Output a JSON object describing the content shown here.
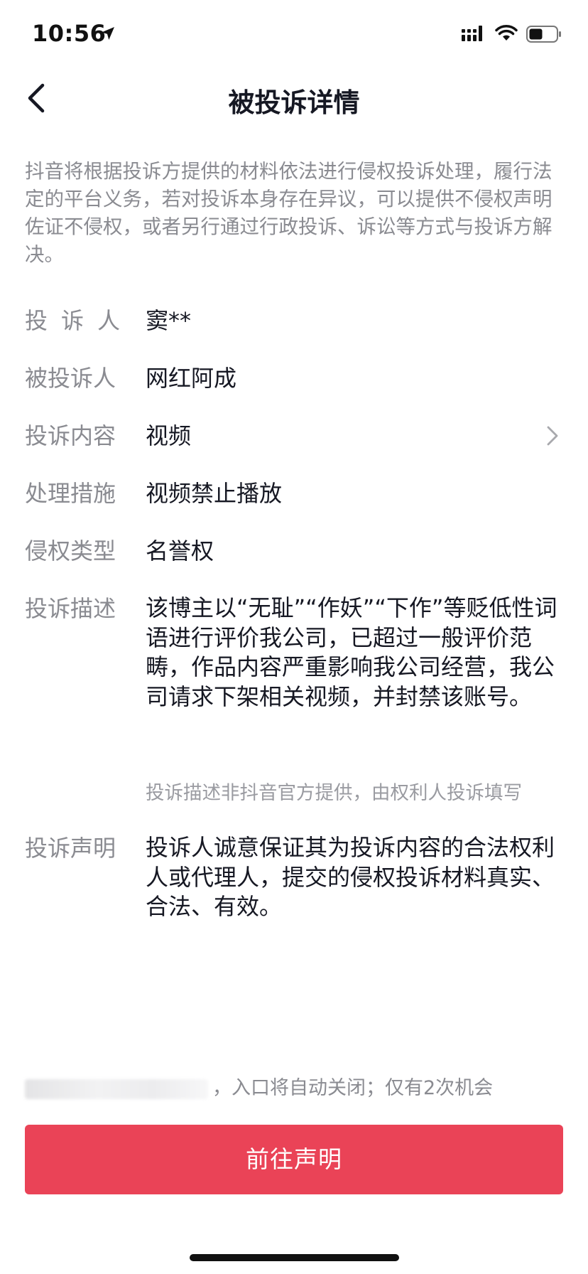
{
  "status_bar": {
    "time": "10:56",
    "icons": [
      "location-arrow-icon",
      "signal-icon",
      "wifi-icon",
      "battery-icon"
    ]
  },
  "nav": {
    "title": "被投诉详情",
    "back_icon": "chevron-left-icon"
  },
  "notice": "抖音将根据投诉方提供的材料依法进行侵权投诉处理，履行法定的平台义务，若对投诉本身存在异议，可以提供不侵权声明佐证不侵权，或者另行通过行政投诉、诉讼等方式与投诉方解决。",
  "details": {
    "complainant": {
      "label": "投诉人",
      "value": "窦**"
    },
    "respondent": {
      "label": "被投诉人",
      "value": "网红阿成"
    },
    "content": {
      "label": "投诉内容",
      "value": "视频",
      "chevron_icon": "chevron-right-icon"
    },
    "measure": {
      "label": "处理措施",
      "value": "视频禁止播放"
    },
    "infringement_type": {
      "label": "侵权类型",
      "value": "名誉权"
    },
    "description": {
      "label": "投诉描述",
      "value": "该博主以“无耻”“作妖”“下作”等贬低性词语进行评价我公司，已超过一般评价范畴，作品内容严重影响我公司经营，我公司请求下架相关视频，并封禁该账号。",
      "note": "投诉描述非抖音官方提供，由权利人投诉填写"
    },
    "statement": {
      "label": "投诉声明",
      "value": "投诉人诚意保证其为投诉内容的合法权利人或代理人，提交的侵权投诉材料真实、合法、有效。"
    }
  },
  "bottom": {
    "hint": "，入口将自动关闭；仅有2次机会",
    "cta_label": "前往声明"
  },
  "colors": {
    "accent": "#ea4357",
    "label_gray": "#8a8b91",
    "text": "#161823"
  }
}
